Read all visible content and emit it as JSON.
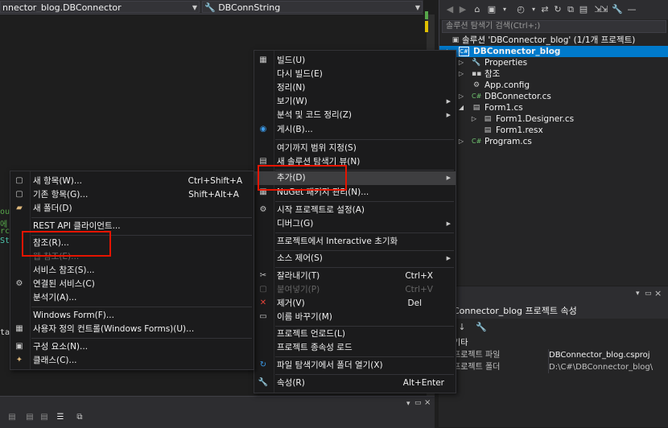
{
  "editor_nav": {
    "class_combo": "nnector_blog.DBConnector",
    "member_combo": "DBConnString"
  },
  "code_fragments": [
    "ou",
    "에",
    "rc",
    "St",
    "ta"
  ],
  "solution_explorer": {
    "search_placeholder": "솔루션 탐색기 검색(Ctrl+;)",
    "tree": [
      {
        "label": "솔루션 'DBConnector_blog' (1/1개 프로젝트)",
        "icon": "solution-icon"
      },
      {
        "label": "DBConnector_blog",
        "icon": "csharp-project-icon",
        "selected": true
      },
      {
        "label": "Properties",
        "icon": "wrench-icon"
      },
      {
        "label": "참조",
        "icon": "references-icon"
      },
      {
        "label": "App.config",
        "icon": "config-file-icon"
      },
      {
        "label": "DBConnector.cs",
        "icon": "csharp-file-icon"
      },
      {
        "label": "Form1.cs",
        "icon": "form-icon"
      },
      {
        "label": "Form1.Designer.cs",
        "icon": "csharp-file-icon"
      },
      {
        "label": "Form1.resx",
        "icon": "resx-file-icon"
      },
      {
        "label": "Program.cs",
        "icon": "csharp-file-icon"
      }
    ]
  },
  "properties": {
    "title": "Connector_blog 프로젝트 속성",
    "category": "기타",
    "rows": [
      {
        "key": "프로젝트 파일",
        "value": "DBConnector_blog.csproj"
      },
      {
        "key": "프로젝트 폴더",
        "value": "D:\\C#\\DBConnector_blog\\"
      }
    ]
  },
  "context_menu": {
    "items": [
      {
        "label": "빌드(U)",
        "icon": "build-icon"
      },
      {
        "label": "다시 빌드(E)"
      },
      {
        "label": "정리(N)"
      },
      {
        "label": "보기(W)",
        "submenu": true
      },
      {
        "label": "분석 및 코드 정리(Z)",
        "submenu": true
      },
      {
        "label": "게시(B)...",
        "icon": "globe-icon"
      },
      {
        "label": "여기까지 범위 지정(S)"
      },
      {
        "label": "새 솔루션 탐색기 뷰(N)",
        "icon": "new-view-icon"
      },
      {
        "label": "추가(D)",
        "submenu": true
      },
      {
        "label": "NuGet 패키지 관리(N)...",
        "icon": "nuget-icon"
      },
      {
        "label": "시작 프로젝트로 설정(A)",
        "icon": "gear-icon"
      },
      {
        "label": "디버그(G)",
        "submenu": true
      },
      {
        "label": "프로젝트에서 Interactive 초기화"
      },
      {
        "label": "소스 제어(S)",
        "submenu": true
      },
      {
        "label": "잘라내기(T)",
        "shortcut": "Ctrl+X",
        "icon": "scissors-icon"
      },
      {
        "label": "붙여넣기(P)",
        "shortcut": "Ctrl+V",
        "icon": "paste-icon"
      },
      {
        "label": "제거(V)",
        "shortcut": "Del",
        "icon": "delete-icon"
      },
      {
        "label": "이름 바꾸기(M)",
        "icon": "rename-icon"
      },
      {
        "label": "프로젝트 언로드(L)"
      },
      {
        "label": "프로젝트 종속성 로드"
      },
      {
        "label": "파일 탐색기에서 폴더 열기(X)",
        "icon": "refresh-folder-icon"
      },
      {
        "label": "속성(R)",
        "shortcut": "Alt+Enter",
        "icon": "wrench-icon"
      }
    ]
  },
  "add_submenu": {
    "items": [
      {
        "label": "새 항목(W)...",
        "shortcut": "Ctrl+Shift+A",
        "icon": "new-item-icon"
      },
      {
        "label": "기존 항목(G)...",
        "shortcut": "Shift+Alt+A",
        "icon": "existing-item-icon"
      },
      {
        "label": "새 폴더(D)",
        "icon": "new-folder-icon"
      },
      {
        "label": "REST API 클라이언트..."
      },
      {
        "label": "참조(R)..."
      },
      {
        "label": "웹 참조(E)..."
      },
      {
        "label": "서비스 참조(S)..."
      },
      {
        "label": "연결된 서비스(C)",
        "icon": "connected-service-icon"
      },
      {
        "label": "분석기(A)..."
      },
      {
        "label": "Windows Form(F)..."
      },
      {
        "label": "사용자 정의 컨트롤(Windows Forms)(U)...",
        "icon": "user-control-icon"
      },
      {
        "label": "구성 요소(N)...",
        "icon": "component-icon"
      },
      {
        "label": "클래스(C)...",
        "icon": "class-icon"
      }
    ]
  },
  "colors": {
    "selection": "#007acc",
    "highlight_box": "#e51400",
    "background": "#1e1e1e"
  }
}
